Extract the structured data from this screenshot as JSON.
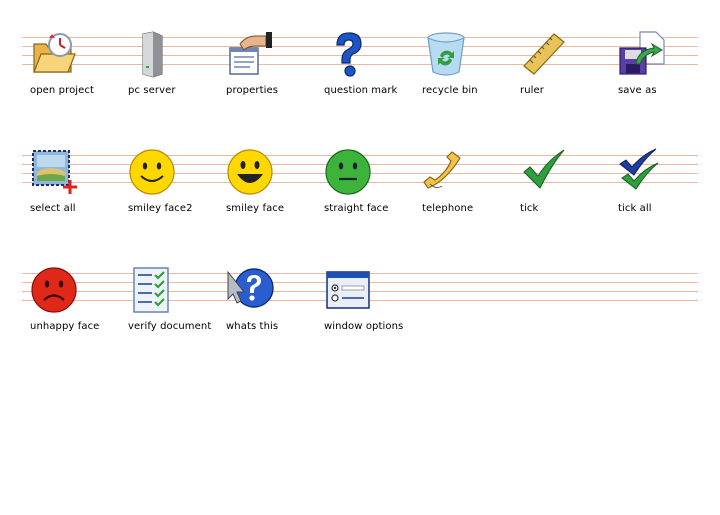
{
  "icons": [
    {
      "label": "open project"
    },
    {
      "label": "pc server"
    },
    {
      "label": "properties"
    },
    {
      "label": "question mark"
    },
    {
      "label": "recycle bin"
    },
    {
      "label": "ruler"
    },
    {
      "label": "save as"
    },
    {
      "label": "select all"
    },
    {
      "label": "smiley face2"
    },
    {
      "label": "smiley face"
    },
    {
      "label": "straight face"
    },
    {
      "label": "telephone"
    },
    {
      "label": "tick"
    },
    {
      "label": "tick all"
    },
    {
      "label": "unhappy face"
    },
    {
      "label": "verify document"
    },
    {
      "label": "whats this"
    },
    {
      "label": "window options"
    }
  ],
  "colors": {
    "guide_line": "#e9b9a4",
    "label_text": "#000000"
  }
}
